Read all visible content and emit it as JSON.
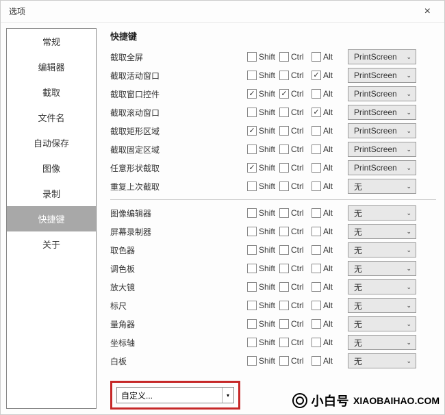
{
  "window": {
    "title": "选项",
    "close": "×"
  },
  "sidebar": {
    "items": [
      {
        "label": "常规"
      },
      {
        "label": "编辑器"
      },
      {
        "label": "截取"
      },
      {
        "label": "文件名"
      },
      {
        "label": "自动保存"
      },
      {
        "label": "图像"
      },
      {
        "label": "录制"
      },
      {
        "label": "快捷键"
      },
      {
        "label": "关于"
      }
    ],
    "selected_index": 7
  },
  "main": {
    "section_title": "快捷键",
    "mod_labels": {
      "shift": "Shift",
      "ctrl": "Ctrl",
      "alt": "Alt"
    },
    "group1": [
      {
        "label": "截取全屏",
        "shift": false,
        "ctrl": false,
        "alt": false,
        "key": "PrintScreen"
      },
      {
        "label": "截取活动窗口",
        "shift": false,
        "ctrl": false,
        "alt": true,
        "key": "PrintScreen"
      },
      {
        "label": "截取窗口控件",
        "shift": true,
        "ctrl": true,
        "alt": false,
        "key": "PrintScreen"
      },
      {
        "label": "截取滚动窗口",
        "shift": false,
        "ctrl": false,
        "alt": true,
        "key": "PrintScreen"
      },
      {
        "label": "截取矩形区域",
        "shift": true,
        "ctrl": false,
        "alt": false,
        "key": "PrintScreen"
      },
      {
        "label": "截取固定区域",
        "shift": false,
        "ctrl": false,
        "alt": false,
        "key": "PrintScreen"
      },
      {
        "label": "任意形状截取",
        "shift": true,
        "ctrl": false,
        "alt": false,
        "key": "PrintScreen"
      },
      {
        "label": "重复上次截取",
        "shift": false,
        "ctrl": false,
        "alt": false,
        "key": "无"
      }
    ],
    "group2": [
      {
        "label": "图像编辑器",
        "shift": false,
        "ctrl": false,
        "alt": false,
        "key": "无"
      },
      {
        "label": "屏幕录制器",
        "shift": false,
        "ctrl": false,
        "alt": false,
        "key": "无"
      },
      {
        "label": "取色器",
        "shift": false,
        "ctrl": false,
        "alt": false,
        "key": "无"
      },
      {
        "label": "调色板",
        "shift": false,
        "ctrl": false,
        "alt": false,
        "key": "无"
      },
      {
        "label": "放大镜",
        "shift": false,
        "ctrl": false,
        "alt": false,
        "key": "无"
      },
      {
        "label": "标尺",
        "shift": false,
        "ctrl": false,
        "alt": false,
        "key": "无"
      },
      {
        "label": "量角器",
        "shift": false,
        "ctrl": false,
        "alt": false,
        "key": "无"
      },
      {
        "label": "坐标轴",
        "shift": false,
        "ctrl": false,
        "alt": false,
        "key": "无"
      },
      {
        "label": "白板",
        "shift": false,
        "ctrl": false,
        "alt": false,
        "key": "无"
      }
    ],
    "custom_label": "自定义..."
  },
  "watermark": {
    "brand": "小白号",
    "url": "XIAOBAIHAO.COM"
  }
}
